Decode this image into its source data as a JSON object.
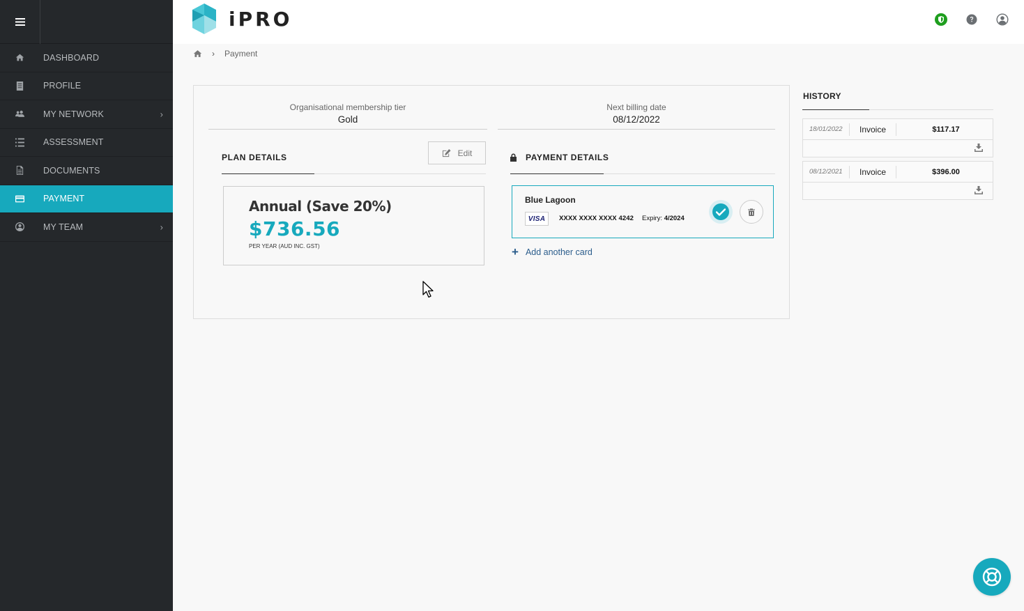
{
  "app": {
    "brand": "iPRO",
    "accent": "#17a9bd",
    "sidebar_bg": "#25282b"
  },
  "sidebar": {
    "items": [
      {
        "label": "DASHBOARD",
        "icon": "home-icon"
      },
      {
        "label": "PROFILE",
        "icon": "document-icon"
      },
      {
        "label": "MY NETWORK",
        "icon": "users-icon",
        "has_submenu": true
      },
      {
        "label": "ASSESSMENT",
        "icon": "list-icon"
      },
      {
        "label": "DOCUMENTS",
        "icon": "file-icon"
      },
      {
        "label": "PAYMENT",
        "icon": "credit-card-icon",
        "active": true
      },
      {
        "label": "MY TEAM",
        "icon": "user-circle-icon",
        "has_submenu": true
      }
    ],
    "chevron": "›"
  },
  "header": {
    "icons": [
      "shield-status-icon",
      "help-icon",
      "account-icon"
    ]
  },
  "breadcrumb": {
    "separator": "›",
    "current": "Payment"
  },
  "membership": {
    "tier_label": "Organisational membership tier",
    "tier_value": "Gold",
    "billing_label": "Next billing date",
    "billing_value": "08/12/2022"
  },
  "plan": {
    "section_title": "PLAN DETAILS",
    "edit_label": "Edit",
    "name": "Annual (Save 20%)",
    "price": "$736.56",
    "per": "PER YEAR (AUD INC. GST)"
  },
  "payment": {
    "section_title": "PAYMENT DETAILS",
    "card": {
      "name": "Blue Lagoon",
      "brand": "VISA",
      "number": "XXXX XXXX XXXX 4242",
      "expiry_label": "Expiry:",
      "expiry_value": "4/2024"
    },
    "add_card_label": "Add another card"
  },
  "history": {
    "title": "HISTORY",
    "items": [
      {
        "date": "18/01/2022",
        "type": "Invoice",
        "amount": "$117.17"
      },
      {
        "date": "08/12/2021",
        "type": "Invoice",
        "amount": "$396.00"
      }
    ]
  }
}
